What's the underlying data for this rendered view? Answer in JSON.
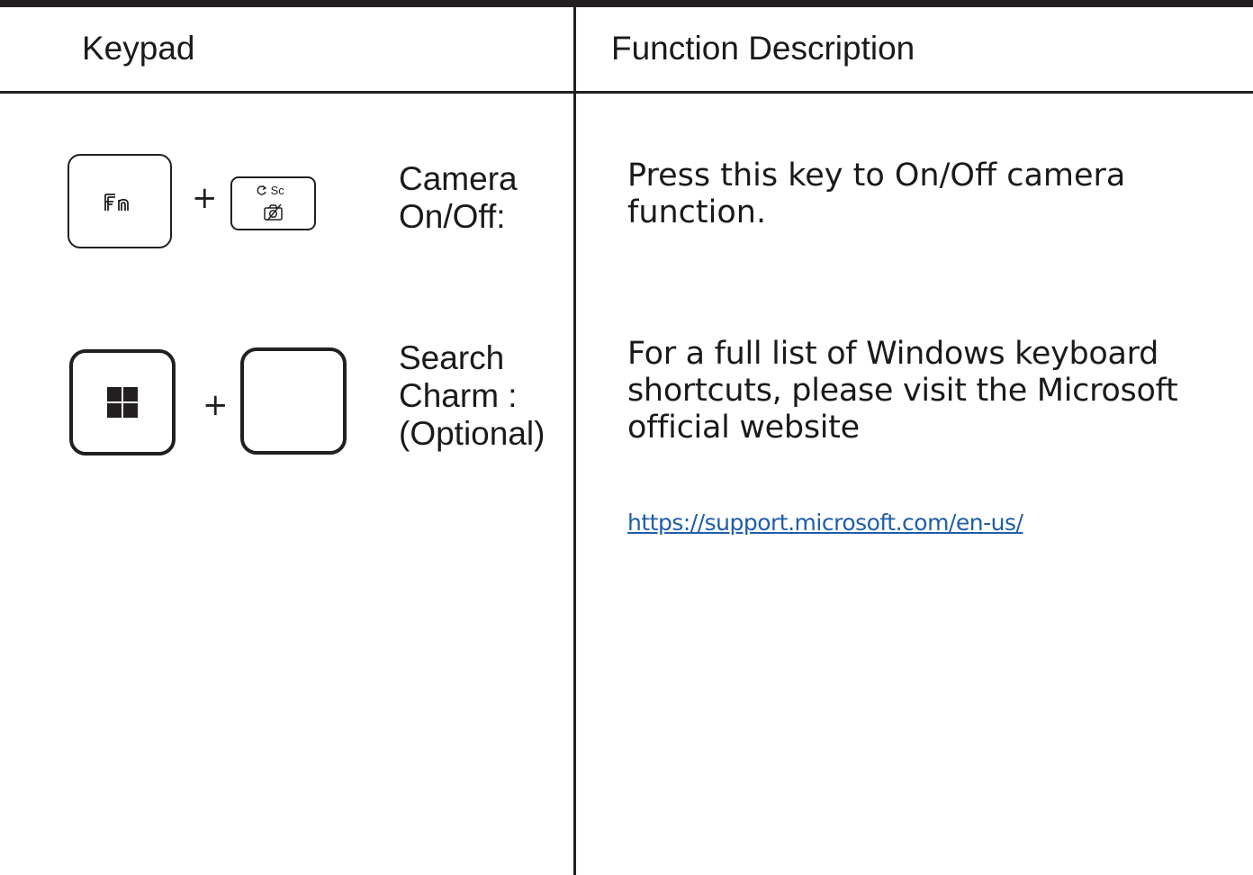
{
  "table": {
    "headers": {
      "keypad": "Keypad",
      "function": "Function Description"
    },
    "rows": [
      {
        "keys": {
          "key1": "fn-key",
          "plus": "+",
          "key2_top": "Sc",
          "key2_icons": [
            "refresh-icon",
            "camera-off-icon"
          ]
        },
        "label_lines": [
          "Camera",
          "On/Off:"
        ],
        "description": "Press this key to On/Off camera function."
      },
      {
        "keys": {
          "key1": "windows-key",
          "plus": "+",
          "key2": "blank-key"
        },
        "label_lines": [
          "Search",
          "Charm :",
          "(Optional)"
        ],
        "description": "For a full list of Windows keyboard shortcuts, please visit the Microsoft official website",
        "link": "https://support.microsoft.com/en-us/"
      }
    ]
  },
  "colors": {
    "rule": "#231f20",
    "text": "#1a1a1a",
    "link": "#1f5ea8"
  }
}
